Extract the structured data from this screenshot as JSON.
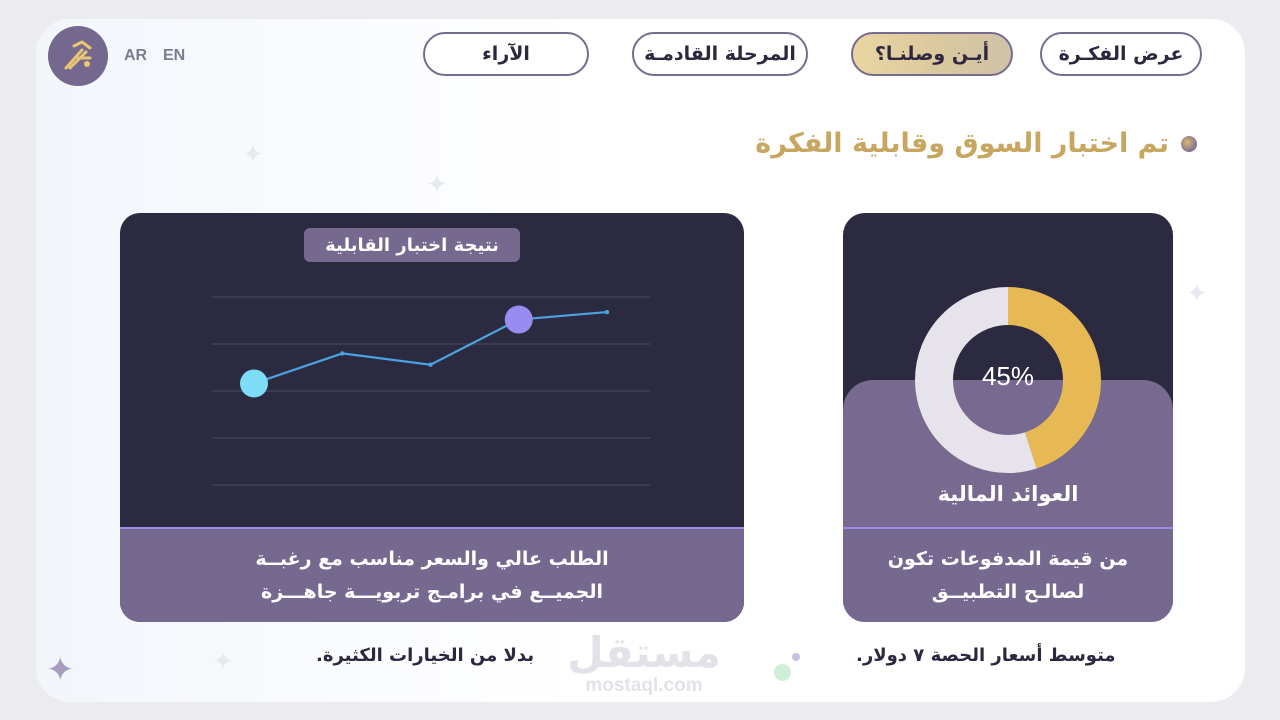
{
  "header": {
    "lang_ar": "AR",
    "lang_en": "EN",
    "nav": [
      {
        "label": "عرض الفكـرة",
        "active": false
      },
      {
        "label": "أيـن وصلنـا؟",
        "active": true
      },
      {
        "label": "المرحلة القادمـة",
        "active": false
      },
      {
        "label": "الآراء",
        "active": false
      }
    ]
  },
  "headline": "تم اختبار السوق وقابلية الفكرة",
  "line_panel": {
    "title": "نتيجة اختبار القابلية",
    "text_line1": "الطلب عالي والسعر مناسب مع رغبــة",
    "text_line2": "الجميــع في برامـج تربويـــة جاهـــزة",
    "caption": "بدلا من الخيارات الكثيرة."
  },
  "donut_panel": {
    "percent_label": "45%",
    "label": "العوائد المالية",
    "text_line1": "من قيمة المدفوعات تكون",
    "text_line2": "لصالـح التطبيــق",
    "caption": "متوسط أسعار الحصة ٧ دولار."
  },
  "watermark": {
    "ar": "مستقل",
    "en": "mostaql.com"
  },
  "chart_data": [
    {
      "type": "line",
      "title": "نتيجة اختبار القابلية",
      "x": [
        1,
        2,
        3,
        4,
        5
      ],
      "series": [
        {
          "values": [
            2.7,
            3.5,
            3.2,
            4.4,
            4.6
          ]
        }
      ],
      "ylim": [
        0,
        5
      ],
      "grid": true,
      "colors": {
        "line": "#4aa3df",
        "start_point": "#7fdcf7",
        "peak_point": "#9a8bf0"
      }
    },
    {
      "type": "pie",
      "donut": true,
      "values": [
        45,
        55
      ],
      "labels": [
        "45%",
        ""
      ],
      "colors": [
        "#e6b955",
        "#e6e4ea"
      ]
    }
  ],
  "colors": {
    "panel_dark": "#2b2a40",
    "panel_purple": "#76698f",
    "accent_gold": "#c7a660"
  }
}
